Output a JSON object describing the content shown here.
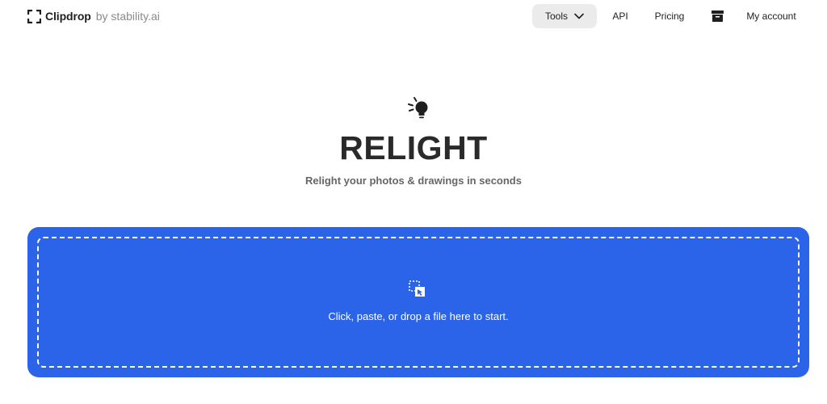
{
  "header": {
    "brand_name": "Clipdrop",
    "brand_by": "by stability.ai",
    "nav": {
      "tools_label": "Tools",
      "api_label": "API",
      "pricing_label": "Pricing",
      "account_label": "My account"
    }
  },
  "hero": {
    "icon": "lightbulb-icon",
    "title": "RELIGHT",
    "subtitle": "Relight your photos & drawings in seconds"
  },
  "dropzone": {
    "icon": "upload-icon",
    "text": "Click, paste, or drop a file here to start."
  },
  "colors": {
    "accent": "#2b64e8",
    "tools_bg": "#ebebeb",
    "title": "#2a2a2a",
    "subtitle": "#666666"
  }
}
